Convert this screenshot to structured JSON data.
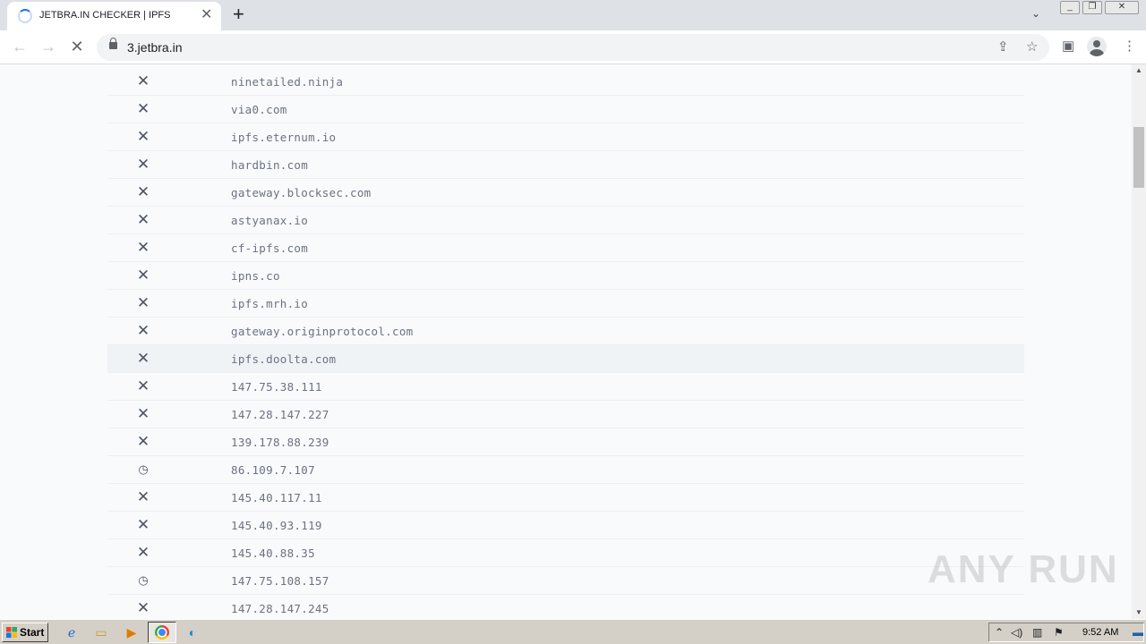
{
  "browser": {
    "tab_title": "JETBRA.IN CHECKER | IPFS",
    "url": "3.jetbra.in",
    "tab_close_glyph": "✕",
    "new_tab_glyph": "+",
    "tab_search_glyph": "⌄"
  },
  "toolbar": {
    "back_glyph": "←",
    "forward_glyph": "→",
    "stop_glyph": "✕",
    "share_glyph": "⇪",
    "bookmark_glyph": "☆",
    "sidepanel_glyph": "▣",
    "menu_glyph": "⋮"
  },
  "window_controls": {
    "minimize": "_",
    "restore": "❐",
    "close": "✕"
  },
  "list": {
    "rows": [
      {
        "status": "failed",
        "glyph": "✕",
        "host": "ninetailed.ninja"
      },
      {
        "status": "failed",
        "glyph": "✕",
        "host": "via0.com"
      },
      {
        "status": "failed",
        "glyph": "✕",
        "host": "ipfs.eternum.io"
      },
      {
        "status": "failed",
        "glyph": "✕",
        "host": "hardbin.com"
      },
      {
        "status": "failed",
        "glyph": "✕",
        "host": "gateway.blocksec.com"
      },
      {
        "status": "failed",
        "glyph": "✕",
        "host": "astyanax.io"
      },
      {
        "status": "failed",
        "glyph": "✕",
        "host": "cf-ipfs.com"
      },
      {
        "status": "failed",
        "glyph": "✕",
        "host": "ipns.co"
      },
      {
        "status": "failed",
        "glyph": "✕",
        "host": "ipfs.mrh.io"
      },
      {
        "status": "failed",
        "glyph": "✕",
        "host": "gateway.originprotocol.com"
      },
      {
        "status": "failed",
        "glyph": "✕",
        "host": "ipfs.doolta.com"
      },
      {
        "status": "failed",
        "glyph": "✕",
        "host": "147.75.38.111"
      },
      {
        "status": "failed",
        "glyph": "✕",
        "host": "147.28.147.227"
      },
      {
        "status": "failed",
        "glyph": "✕",
        "host": "139.178.88.239"
      },
      {
        "status": "pending",
        "glyph": "◷",
        "host": "86.109.7.107"
      },
      {
        "status": "failed",
        "glyph": "✕",
        "host": "145.40.117.11"
      },
      {
        "status": "failed",
        "glyph": "✕",
        "host": "145.40.93.119"
      },
      {
        "status": "failed",
        "glyph": "✕",
        "host": "145.40.88.35"
      },
      {
        "status": "pending",
        "glyph": "◷",
        "host": "147.75.108.157"
      },
      {
        "status": "failed",
        "glyph": "✕",
        "host": "147.28.147.245"
      }
    ]
  },
  "watermark": {
    "text": "ANY RUN"
  },
  "taskbar": {
    "start_label": "Start",
    "clock": "9:52 AM",
    "quick_launch": [
      {
        "name": "ie-icon",
        "glyph": "ℯ"
      },
      {
        "name": "folder-icon",
        "glyph": "▭"
      },
      {
        "name": "media-player-icon",
        "glyph": "▶"
      },
      {
        "name": "edge-icon",
        "glyph": "◐"
      }
    ]
  },
  "colors": {
    "accent": "#1a73e8",
    "page_background": "#f8fafc",
    "row_text": "#6b7280",
    "status_icon": "#4b5563"
  }
}
